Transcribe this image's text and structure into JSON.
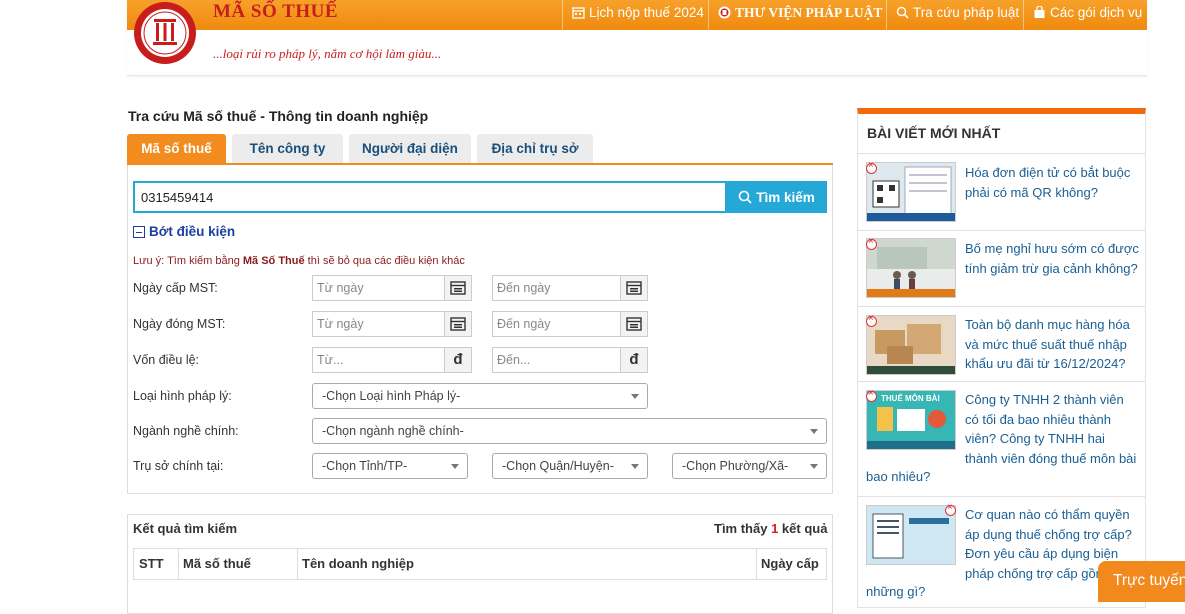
{
  "header": {
    "brand": "MÃ SỐ THUẾ",
    "slogan": "...loại rủi ro pháp lý, nắm cơ hội làm giàu...",
    "nav": [
      {
        "label": "Lịch nộp thuế 2024",
        "icon": "calendar-icon"
      },
      {
        "label": "THƯ VIỆN PHÁP LUẬT",
        "icon": "tvpl-logo-icon"
      },
      {
        "label": "Tra cứu pháp luật",
        "icon": "search-icon"
      },
      {
        "label": "Các gói dịch vụ",
        "icon": "bag-icon"
      }
    ]
  },
  "main": {
    "title": "Tra cứu Mã số thuế - Thông tin doanh nghiệp",
    "tabs": [
      "Mã số thuế",
      "Tên công ty",
      "Người đại diện",
      "Địa chỉ trụ sở"
    ],
    "active_tab": 0,
    "search_value": "0315459414",
    "search_button": "Tìm kiếm",
    "collapse_label": "Bớt điều kiện",
    "note_prefix": "Lưu ý: Tìm kiếm bằng ",
    "note_bold": "Mã Số Thuế",
    "note_suffix": " thì sẽ bỏ qua các điều kiện khác",
    "filters": {
      "issue_date_label": "Ngày cấp MST:",
      "close_date_label": "Ngày đóng MST:",
      "capital_label": "Vốn điều lệ:",
      "legal_type_label": "Loại hình pháp lý:",
      "industry_label": "Ngành nghề chính:",
      "hq_label": "Trụ sở chính tại:",
      "from_date": "Từ ngày",
      "to_date": "Đến ngày",
      "from_amount": "Từ...",
      "to_amount": "Đến...",
      "currency": "đ",
      "legal_type_select": "-Chọn Loại hình Pháp lý-",
      "industry_select": "-Chọn ngành nghề chính-",
      "province_select": "-Chọn Tỉnh/TP-",
      "district_select": "-Chọn Quận/Huyện-",
      "ward_select": "-Chọn Phường/Xã-"
    },
    "results": {
      "title": "Kết quả tìm kiếm",
      "count_prefix": "Tìm thấy ",
      "count": "1",
      "count_suffix": " kết quả",
      "columns": [
        "STT",
        "Mã số thuế",
        "Tên doanh nghiệp",
        "Ngày cấp"
      ]
    }
  },
  "sidebar": {
    "title": "BÀI VIẾT MỚI NHẤT",
    "articles": [
      "Hóa đơn điện tử có bắt buộc phải có mã QR không?",
      "Bố mẹ nghỉ hưu sớm có được tính giảm trừ gia cảnh không?",
      "Toàn bộ danh mục hàng hóa và mức thuế suất thuế nhập khẩu ưu đãi từ 16/12/2024?",
      "Công ty TNHH 2 thành viên có tối đa bao nhiêu thành viên? Công ty TNHH hai thành viên đóng thuế môn bài",
      "bao nhiêu?",
      "Cơ quan nào có thẩm quyền áp dụng thuế chống trợ cấp? Đơn yêu cầu áp dụng biện pháp chống trợ cấp gồm",
      "những gì?"
    ],
    "thumb4_caption": "THUẾ MÔN BÀI"
  },
  "chat": {
    "label": "Trực tuyến"
  },
  "colors": {
    "orange": "#f28c1e",
    "blue": "#25a8d6",
    "red": "#c81d1d",
    "link": "#1a5f94"
  }
}
